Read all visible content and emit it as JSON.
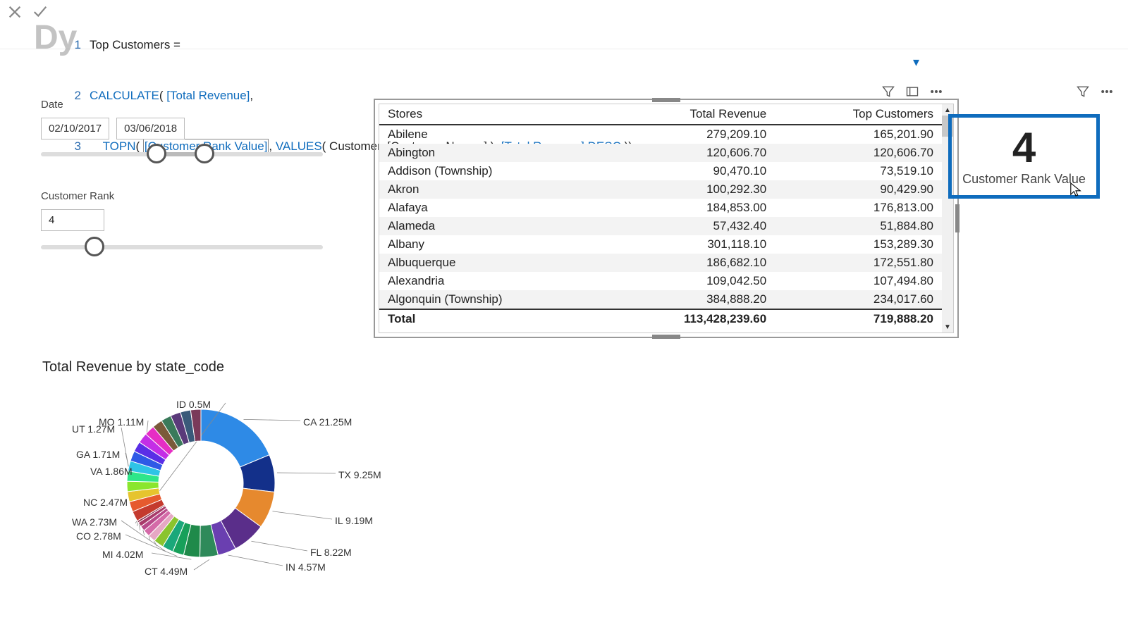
{
  "formula": {
    "lines": [
      {
        "no": "1",
        "plain": "Top Customers ="
      },
      {
        "no": "2",
        "plain": "CALCULATE( [Total Revenue],"
      },
      {
        "no": "3",
        "plain": "    TOPN( [Customer Rank Value], VALUES( Customers[Customer Names] ), [Total Revenue],DESC ))"
      }
    ],
    "watermark": "Dy"
  },
  "date_slicer": {
    "title": "Date",
    "from": "02/10/2017",
    "to": "03/06/2018",
    "handle1_pct": 41,
    "handle2_pct": 58
  },
  "rank_slicer": {
    "title": "Customer Rank",
    "value": "4",
    "handle_pct": 19
  },
  "table": {
    "headers": [
      "Stores",
      "Total Revenue",
      "Top Customers"
    ],
    "rows": [
      {
        "store": "Abilene",
        "rev": "279,209.10",
        "top": "165,201.90"
      },
      {
        "store": "Abington",
        "rev": "120,606.70",
        "top": "120,606.70"
      },
      {
        "store": "Addison (Township)",
        "rev": "90,470.10",
        "top": "73,519.10"
      },
      {
        "store": "Akron",
        "rev": "100,292.30",
        "top": "90,429.90"
      },
      {
        "store": "Alafaya",
        "rev": "184,853.00",
        "top": "176,813.00"
      },
      {
        "store": "Alameda",
        "rev": "57,432.40",
        "top": "51,884.80"
      },
      {
        "store": "Albany",
        "rev": "301,118.10",
        "top": "153,289.30"
      },
      {
        "store": "Albuquerque",
        "rev": "186,682.10",
        "top": "172,551.80"
      },
      {
        "store": "Alexandria",
        "rev": "109,042.50",
        "top": "107,494.80"
      },
      {
        "store": "Algonquin (Township)",
        "rev": "384,888.20",
        "top": "234,017.60"
      }
    ],
    "total": {
      "label": "Total",
      "rev": "113,428,239.60",
      "top": "719,888.20"
    }
  },
  "card": {
    "value": "4",
    "label": "Customer Rank Value"
  },
  "chart_data": {
    "type": "pie",
    "title": "Total Revenue by state_code",
    "unit": "M",
    "slices": [
      {
        "label": "CA",
        "value": 21.25,
        "color": "#2e8ae6"
      },
      {
        "label": "TX",
        "value": 9.25,
        "color": "#13308a"
      },
      {
        "label": "IL",
        "value": 9.19,
        "color": "#e6892e"
      },
      {
        "label": "FL",
        "value": 8.22,
        "color": "#5a2e8a"
      },
      {
        "label": "IN",
        "value": 4.57,
        "color": "#6a3fb0"
      },
      {
        "label": "CT",
        "value": 4.49,
        "color": "#2e8a5a"
      },
      {
        "label": "MI",
        "value": 4.02,
        "color": "#1f8a4a"
      },
      {
        "label": "CO",
        "value": 2.78,
        "color": "#17a05a"
      },
      {
        "label": "WA",
        "value": 2.73,
        "color": "#1aa87a"
      },
      {
        "label": "NC",
        "value": 2.47,
        "color": "#8ac42e"
      },
      {
        "label": "VA",
        "value": 1.86,
        "color": "#e6a8c4"
      },
      {
        "label": "GA",
        "value": 1.71,
        "color": "#d46aa8"
      },
      {
        "label": "UT",
        "value": 1.27,
        "color": "#b84a8a"
      },
      {
        "label": "MO",
        "value": 1.11,
        "color": "#a83a6a"
      },
      {
        "label": "ID",
        "value": 0.5,
        "color": "#8a2e4a"
      }
    ],
    "other_total": 38.0,
    "other_colors": [
      "#c43a2e",
      "#e65a2e",
      "#e6c42e",
      "#8ae62e",
      "#2ee68a",
      "#2ec4e6",
      "#2e5ae6",
      "#5a2ee6",
      "#c42ee6",
      "#e62ec4",
      "#7a5a3a",
      "#3a7a5a",
      "#5a3a7a",
      "#3a5a7a",
      "#7a3a5a"
    ],
    "labels_text": {
      "CA": "CA 21.25M",
      "TX": "TX 9.25M",
      "IL": "IL 9.19M",
      "FL": "FL 8.22M",
      "IN": "IN 4.57M",
      "CT": "CT 4.49M",
      "MI": "MI 4.02M",
      "CO": "CO 2.78M",
      "WA": "WA 2.73M",
      "NC": "NC 2.47M",
      "VA": "VA 1.86M",
      "GA": "GA 1.71M",
      "UT": "UT 1.27M",
      "MO": "MO 1.11M",
      "ID": "ID 0.5M"
    }
  }
}
